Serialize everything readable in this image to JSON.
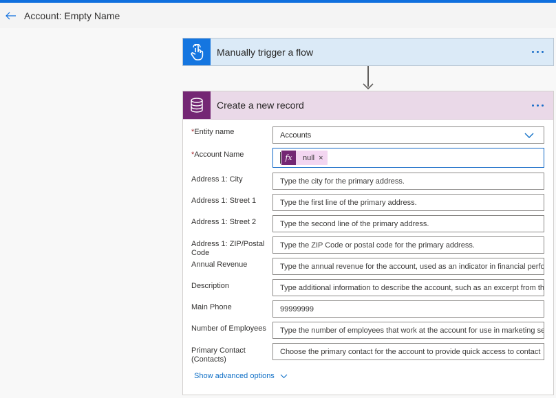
{
  "header": {
    "title": "Account: Empty Name"
  },
  "trigger": {
    "title": "Manually trigger a flow",
    "icon": "touch-hand-icon"
  },
  "action": {
    "title": "Create a new record",
    "icon": "database-icon",
    "fields": [
      {
        "label": "Entity name",
        "required": "*",
        "value": "Accounts",
        "type": "dropdown"
      },
      {
        "label": "Account Name",
        "required": "*",
        "token": {
          "symbol": "fx",
          "text": "null",
          "remove": "×"
        }
      },
      {
        "label": "Address 1: City",
        "placeholder": "Type the city for the primary address."
      },
      {
        "label": "Address 1: Street 1",
        "placeholder": "Type the first line of the primary address."
      },
      {
        "label": "Address 1: Street 2",
        "placeholder": "Type the second line of the primary address."
      },
      {
        "label": "Address 1: ZIP/Postal Code",
        "placeholder": "Type the ZIP Code or postal code for the primary address."
      },
      {
        "label": "Annual Revenue",
        "placeholder": "Type the annual revenue for the account, used as an indicator in financial perfo"
      },
      {
        "label": "Description",
        "placeholder": "Type additional information to describe the account, such as an excerpt from th"
      },
      {
        "label": "Main Phone",
        "value": "99999999"
      },
      {
        "label": "Number of Employees",
        "placeholder": "Type the number of employees that work at the account for use in marketing se"
      },
      {
        "label": "Primary Contact (Contacts)",
        "placeholder": "Choose the primary contact for the account to provide quick access to contact"
      }
    ],
    "advanced_label": "Show advanced options"
  },
  "colors": {
    "accent": "#0f6fde",
    "trigger_bg": "#dbeaf7",
    "action_bg": "#ead9e8",
    "action_icon": "#742774"
  }
}
